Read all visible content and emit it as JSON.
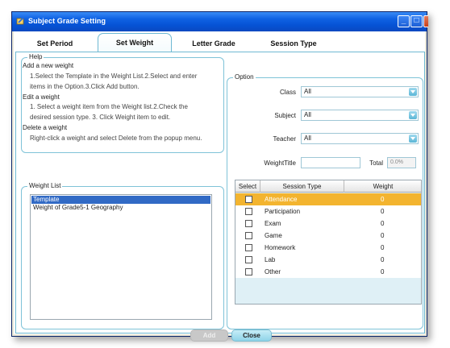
{
  "window": {
    "title": "Subject Grade Setting",
    "controls": [
      "minimize-icon",
      "maximize-icon",
      "close-icon"
    ]
  },
  "tabs": [
    {
      "label": "Set Period",
      "active": false
    },
    {
      "label": "Set Weight",
      "active": true
    },
    {
      "label": "Letter Grade",
      "active": false
    },
    {
      "label": "Session Type",
      "active": false
    }
  ],
  "help": {
    "legend": "Help",
    "add_title": "Add a new weight",
    "add_line1": "1.Select the Template in the Weight List.2.Select and enter",
    "add_line2": "items in the Option.3.Click Add button.",
    "edit_title": "Edit a weight",
    "edit_line1": "1. Select a weight item from the Weight list.2.Check the",
    "edit_line2": "desired session type. 3. Click Weight item to edit.",
    "delete_title": "Delete a weight",
    "delete_line1": "Right-click a weight and select Delete from the popup menu."
  },
  "weight_list": {
    "legend": "Weight List",
    "items": [
      {
        "label": "Template",
        "selected": true
      },
      {
        "label": "Weight of Grade5-1 Geography",
        "selected": false
      }
    ]
  },
  "option": {
    "legend": "Option",
    "class_label": "Class",
    "class_value": "All",
    "subject_label": "Subject",
    "subject_value": "All",
    "teacher_label": "Teacher",
    "teacher_value": "All",
    "weight_title_label": "WeightTitle",
    "weight_title_value": "",
    "total_label": "Total",
    "total_value": "0.0%"
  },
  "session_grid": {
    "columns": [
      "Select",
      "Session Type",
      "Weight"
    ],
    "rows": [
      {
        "type": "Attendance",
        "weight": "0",
        "selected": true,
        "checked": false
      },
      {
        "type": "Participation",
        "weight": "0",
        "selected": false,
        "checked": false
      },
      {
        "type": "Exam",
        "weight": "0",
        "selected": false,
        "checked": false
      },
      {
        "type": "Game",
        "weight": "0",
        "selected": false,
        "checked": false
      },
      {
        "type": "Homework",
        "weight": "0",
        "selected": false,
        "checked": false
      },
      {
        "type": "Lab",
        "weight": "0",
        "selected": false,
        "checked": false
      },
      {
        "type": "Other",
        "weight": "0",
        "selected": false,
        "checked": false
      }
    ]
  },
  "buttons": {
    "add_label": "Add",
    "close_label": "Close"
  },
  "colors": {
    "titlebar": "#0652d4",
    "accent_border": "#6fb9d3",
    "selection_blue": "#316ac5",
    "selected_row": "#f3b42f"
  }
}
